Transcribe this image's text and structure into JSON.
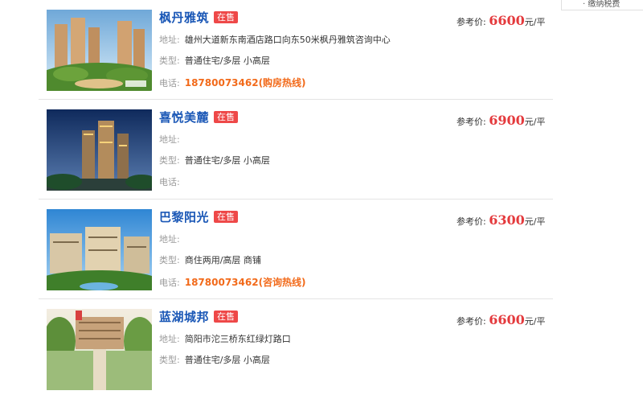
{
  "sidebar": {
    "link": "· 缴纳税费"
  },
  "listings": [
    {
      "name": "枫丹雅筑",
      "status": "在售",
      "address_label": "地址:",
      "address": "雄州大道新东南酒店路口向东50米枫丹雅筑咨询中心",
      "type_label": "类型:",
      "type": "普通住宅/多层 小高层",
      "phone_label": "电话:",
      "phone": "18780073462(购房热线)",
      "price_label": "参考价:",
      "price": "6600",
      "price_unit": "元/平"
    },
    {
      "name": "喜悦美麓",
      "status": "在售",
      "address_label": "地址:",
      "address": "",
      "type_label": "类型:",
      "type": "普通住宅/多层 小高层",
      "phone_label": "电话:",
      "phone": "",
      "price_label": "参考价:",
      "price": "6900",
      "price_unit": "元/平"
    },
    {
      "name": "巴黎阳光",
      "status": "在售",
      "address_label": "地址:",
      "address": "",
      "type_label": "类型:",
      "type": "商住两用/高层 商铺",
      "phone_label": "电话:",
      "phone": "18780073462(咨询热线)",
      "price_label": "参考价:",
      "price": "6300",
      "price_unit": "元/平"
    },
    {
      "name": "蓝湖城邦",
      "status": "在售",
      "address_label": "地址:",
      "address": "简阳市沱三桥东红绿灯路口",
      "type_label": "类型:",
      "type": "普通住宅/多层 小高层",
      "phone_label": "电话:",
      "phone": "",
      "price_label": "参考价:",
      "price": "6600",
      "price_unit": "元/平"
    }
  ]
}
